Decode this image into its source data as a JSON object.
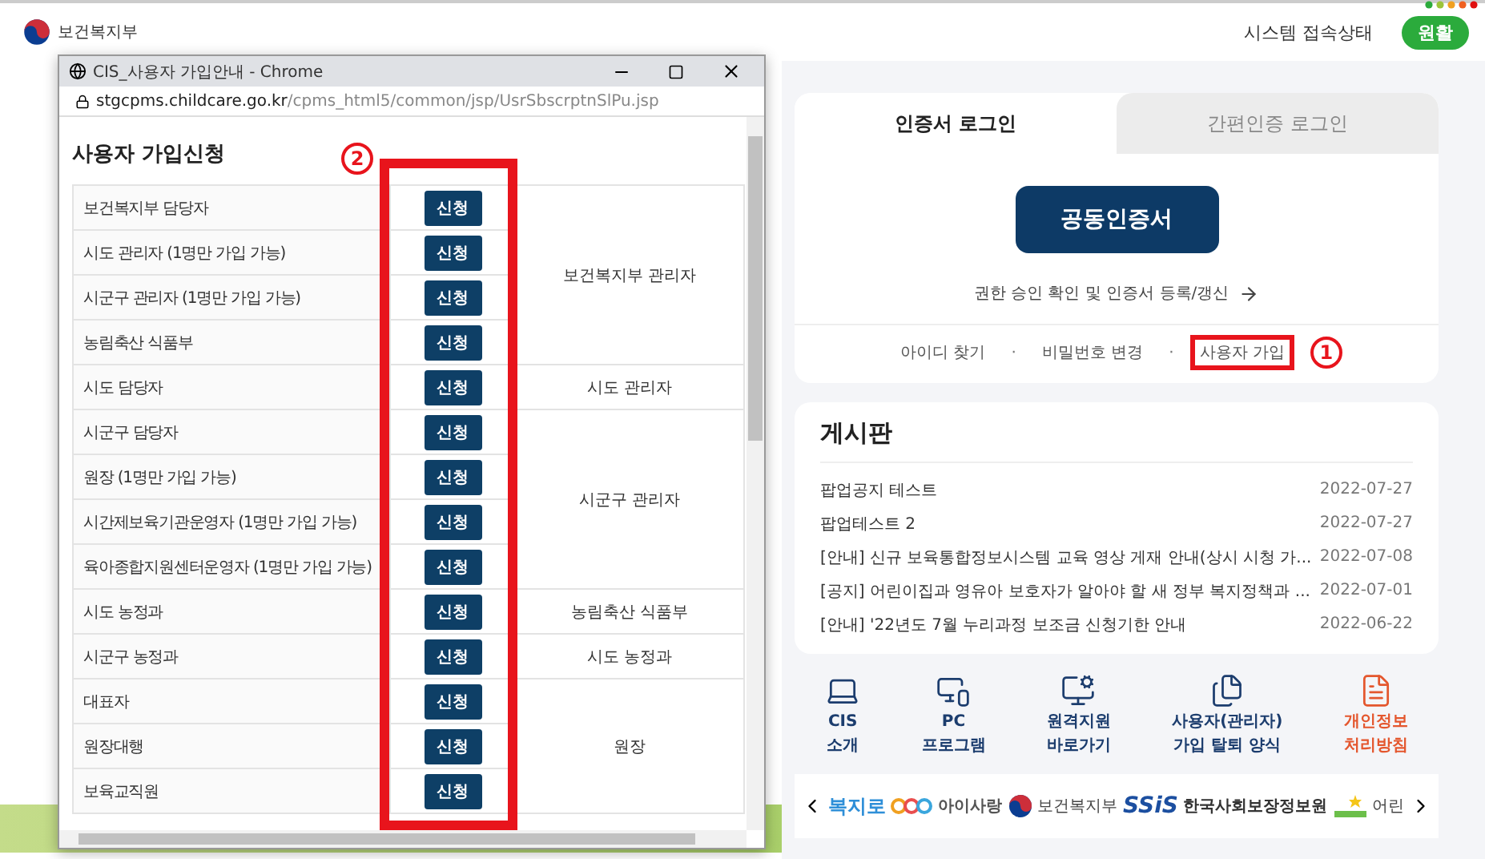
{
  "header": {
    "logo_text": "보건복지부",
    "status_label": "시스템 접속상태",
    "status_value": "원활"
  },
  "popup": {
    "title": "CIS_사용자 가입안내 - Chrome",
    "url_host": "stgcpms.childcare.go.kr",
    "url_path": "/cpms_html5/common/jsp/UsrSbscrptnSlPu.jsp",
    "heading": "사용자 가입신청",
    "annotation": "2",
    "groups": [
      {
        "name": "보건복지부 관리자",
        "roles": [
          {
            "label": "보건복지부 담당자",
            "button": "신청"
          },
          {
            "label": "시도 관리자 (1명만 가입 가능)",
            "button": "신청"
          },
          {
            "label": "시군구 관리자 (1명만 가입 가능)",
            "button": "신청"
          },
          {
            "label": "농림축산 식품부",
            "button": "신청"
          }
        ]
      },
      {
        "name": "시도 관리자",
        "roles": [
          {
            "label": "시도 담당자",
            "button": "신청"
          }
        ]
      },
      {
        "name": "시군구 관리자",
        "roles": [
          {
            "label": "시군구 담당자",
            "button": "신청"
          },
          {
            "label": "원장 (1명만 가입 가능)",
            "button": "신청"
          },
          {
            "label": "시간제보육기관운영자 (1명만 가입 가능)",
            "button": "신청"
          },
          {
            "label": "육아종합지원센터운영자 (1명만 가입 가능)",
            "button": "신청"
          }
        ]
      },
      {
        "name": "농림축산 식품부",
        "roles": [
          {
            "label": "시도 농정과",
            "button": "신청"
          }
        ]
      },
      {
        "name": "시도 농정과",
        "roles": [
          {
            "label": "시군구 농정과",
            "button": "신청"
          }
        ]
      },
      {
        "name": "원장",
        "roles": [
          {
            "label": "대표자",
            "button": "신청"
          },
          {
            "label": "원장대행",
            "button": "신청"
          },
          {
            "label": "보육교직원",
            "button": "신청"
          }
        ]
      }
    ]
  },
  "login": {
    "tabs": [
      {
        "label": "인증서 로그인",
        "selected": true
      },
      {
        "label": "간편인증 로그인",
        "selected": false
      }
    ],
    "cert_button": "공동인증서",
    "separator": "·",
    "renew_link": "권한 승인 확인 및 인증서 등록/갱신",
    "links": [
      {
        "label": "아이디 찾기"
      },
      {
        "label": "비밀번호 변경"
      },
      {
        "label": "사용자 가입",
        "annotation": "1"
      }
    ]
  },
  "board": {
    "title": "게시판",
    "posts": [
      {
        "title": "팝업공지 테스트",
        "date": "2022-07-27"
      },
      {
        "title": "팝업테스트 2",
        "date": "2022-07-27"
      },
      {
        "title": "[안내] 신규 보육통합정보시스템 교육 영상 게재 안내(상시 시청 가...",
        "date": "2022-07-08"
      },
      {
        "title": "[공지] 어린이집과 영유아 보호자가 알아야 할 새 정부 복지정책과 ...",
        "date": "2022-07-01"
      },
      {
        "title": "[안내] '22년도 7월 누리과정 보조금 신청기한 안내",
        "date": "2022-06-22"
      }
    ]
  },
  "quick_links": [
    {
      "kind": "laptop",
      "lines": [
        "CIS",
        "소개"
      ],
      "accent": false
    },
    {
      "kind": "monitor",
      "lines": [
        "PC",
        "프로그램"
      ],
      "accent": false
    },
    {
      "kind": "remote",
      "lines": [
        "원격지원",
        "바로가기"
      ],
      "accent": false
    },
    {
      "kind": "documents",
      "lines": [
        "사용자(관리자)",
        "가입 탈퇴 양식"
      ],
      "accent": false
    },
    {
      "kind": "list",
      "lines": [
        "개인정보",
        "처리방침"
      ],
      "accent": true
    }
  ],
  "partners": [
    {
      "kind": "bokjiro",
      "text": "복지로"
    },
    {
      "kind": "isarang",
      "text": "아이사랑"
    },
    {
      "kind": "ministry",
      "text": "보건복지부"
    },
    {
      "kind": "ssis",
      "text": "SSiS",
      "subtext": "한국사회보장정보원"
    },
    {
      "kind": "kids",
      "text": "어린"
    }
  ]
}
